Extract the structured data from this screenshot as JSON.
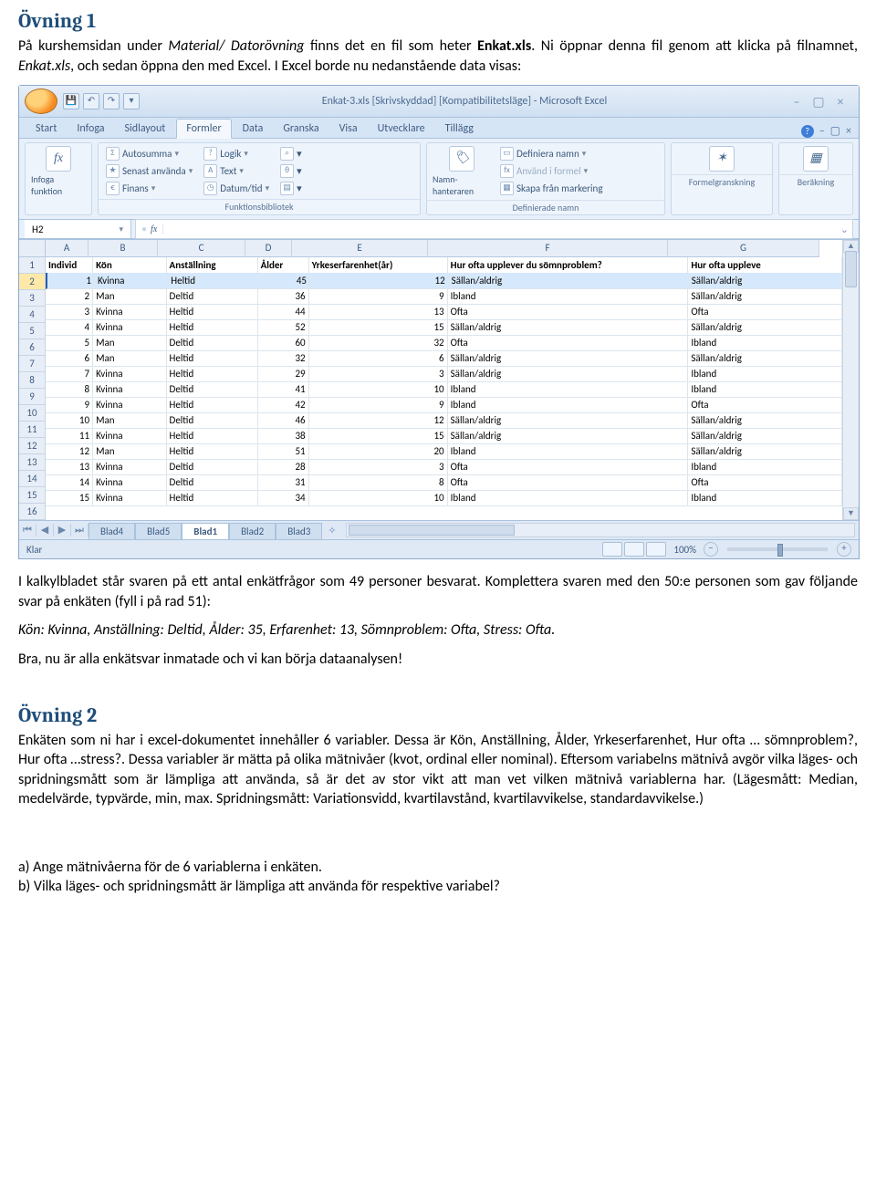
{
  "ovning1": {
    "heading": "Övning 1",
    "p1_a": "På kurshemsidan under ",
    "p1_b": "Material/ Datorövning",
    "p1_c": " finns det en fil som heter ",
    "p1_d": "Enkat.xls",
    "p1_e": ". Ni öppnar denna fil genom att klicka på filnamnet, ",
    "p1_f": "Enkat.xls",
    "p1_g": ", och sedan öppna den med Excel. I Excel borde nu nedanstående data visas:",
    "after_excel_a": "I kalkylbladet står svaren på ett antal enkätfrågor som 49 personer besvarat. Komplettera svaren med den 50:e personen som gav följande svar på enkäten (fyll i på rad 51):",
    "after_excel_b": "Kön: Kvinna, Anställning: Deltid, Ålder: 35, Erfarenhet: 13, Sömnproblem: Ofta, Stress: Ofta.",
    "after_excel_c": "Bra, nu är alla enkätsvar inmatade och vi kan börja dataanalysen!"
  },
  "ovning2": {
    "heading": "Övning 2",
    "p1": "Enkäten som ni har i excel-dokumentet innehåller 6 variabler. Dessa är Kön, Anställning, Ålder, Yrkeserfarenhet, Hur ofta … sömnproblem?, Hur ofta …stress?. Dessa variabler är mätta på olika mätnivåer (kvot, ordinal eller nominal). Eftersom variabelns mätnivå avgör vilka läges- och spridningsmått som är lämpliga att använda, så är det av stor vikt att man vet vilken mätnivå variablerna har. (Lägesmått: Median, medelvärde, typvärde, min, max. Spridningsmått: Variationsvidd, kvartilavstånd, kvartilavvikelse, standardavvikelse.)",
    "q_a": "a)   Ange mätnivåerna för de 6 variablerna i enkäten.",
    "q_b": "b)   Vilka läges- och spridningsmått är lämpliga att använda för respektive variabel?"
  },
  "excel": {
    "title": "Enkat-3.xls  [Skrivskyddad]  [Kompatibilitetsläge] - Microsoft Excel",
    "tabs": [
      "Start",
      "Infoga",
      "Sidlayout",
      "Formler",
      "Data",
      "Granska",
      "Visa",
      "Utvecklare",
      "Tillägg"
    ],
    "active_tab": 3,
    "ribbon": {
      "insert_fn": "Infoga funktion",
      "funclib": {
        "autosumma": "Autosumma",
        "senast": "Senast använda",
        "finans": "Finans",
        "logik": "Logik",
        "text": "Text",
        "datum": "Datum/tid",
        "group": "Funktionsbibliotek"
      },
      "names": {
        "big": "Namn- hanteraren",
        "def": "Definiera namn",
        "use": "Använd i formel",
        "create": "Skapa från markering",
        "group": "Definierade namn"
      },
      "audit": "Formelgranskning",
      "calc": "Beräkning"
    },
    "namebox": "H2",
    "formula": "",
    "cols": [
      "A",
      "B",
      "C",
      "D",
      "E",
      "F",
      "G"
    ],
    "headers": [
      "Individ",
      "Kön",
      "Anställning",
      "Ålder",
      "Yrkeserfarenhet(år)",
      "Hur ofta upplever du sömnproblem?",
      "Hur ofta uppleve"
    ],
    "rows": [
      [
        1,
        "Kvinna",
        "Heltid",
        45,
        12,
        "Sällan/aldrig",
        "Sällan/aldrig"
      ],
      [
        2,
        "Man",
        "Deltid",
        36,
        9,
        "Ibland",
        "Sällan/aldrig"
      ],
      [
        3,
        "Kvinna",
        "Heltid",
        44,
        13,
        "Ofta",
        "Ofta"
      ],
      [
        4,
        "Kvinna",
        "Heltid",
        52,
        15,
        "Sällan/aldrig",
        "Sällan/aldrig"
      ],
      [
        5,
        "Man",
        "Deltid",
        60,
        32,
        "Ofta",
        "Ibland"
      ],
      [
        6,
        "Man",
        "Heltid",
        32,
        6,
        "Sällan/aldrig",
        "Sällan/aldrig"
      ],
      [
        7,
        "Kvinna",
        "Heltid",
        29,
        3,
        "Sällan/aldrig",
        "Ibland"
      ],
      [
        8,
        "Kvinna",
        "Deltid",
        41,
        10,
        "Ibland",
        "Ibland"
      ],
      [
        9,
        "Kvinna",
        "Heltid",
        42,
        9,
        "Ibland",
        "Ofta"
      ],
      [
        10,
        "Man",
        "Deltid",
        46,
        12,
        "Sällan/aldrig",
        "Sällan/aldrig"
      ],
      [
        11,
        "Kvinna",
        "Heltid",
        38,
        15,
        "Sällan/aldrig",
        "Sällan/aldrig"
      ],
      [
        12,
        "Man",
        "Heltid",
        51,
        20,
        "Ibland",
        "Sällan/aldrig"
      ],
      [
        13,
        "Kvinna",
        "Deltid",
        28,
        3,
        "Ofta",
        "Ibland"
      ],
      [
        14,
        "Kvinna",
        "Deltid",
        31,
        8,
        "Ofta",
        "Ofta"
      ],
      [
        15,
        "Kvinna",
        "Heltid",
        34,
        10,
        "Ibland",
        "Ibland"
      ]
    ],
    "sheets": [
      "Blad4",
      "Blad5",
      "Blad1",
      "Blad2",
      "Blad3"
    ],
    "active_sheet": 2,
    "status": "Klar",
    "zoom": "100%"
  }
}
